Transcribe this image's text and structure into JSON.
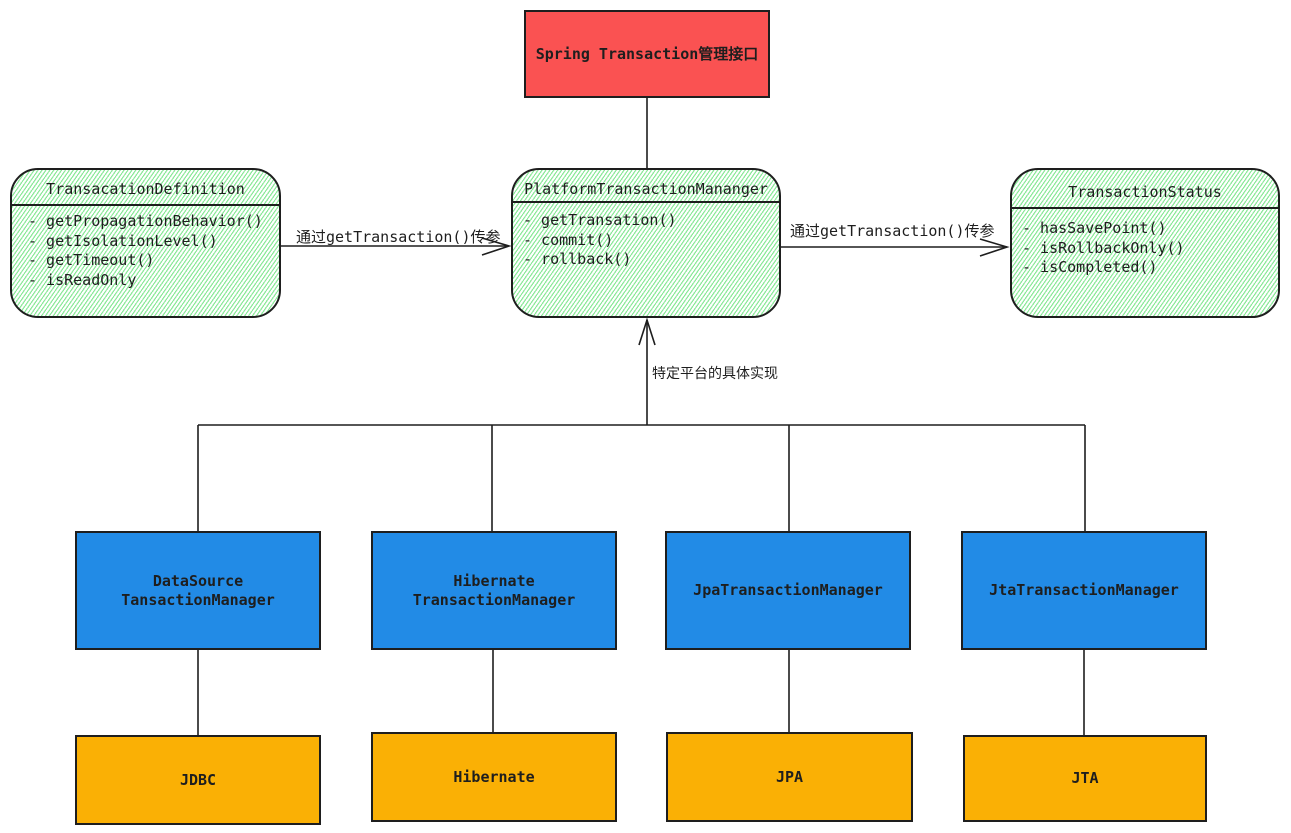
{
  "top": {
    "label": "Spring Transaction管理接口",
    "color": "#fa5252"
  },
  "definition": {
    "title": "TransacationDefinition",
    "methods": [
      "- getPropagationBehavior()",
      "- getIsolationLevel()",
      "- getTimeout()",
      "- isReadOnly"
    ]
  },
  "manager": {
    "title": "PlatformTransactionMananger",
    "methods": [
      "- getTransation()",
      "- commit()",
      "- rollback()"
    ]
  },
  "status": {
    "title": "TransactionStatus",
    "methods": [
      "- hasSavePoint()",
      "- isRollbackOnly()",
      "- isCompleted()"
    ]
  },
  "edges": {
    "left_label": "通过getTransaction()传参",
    "right_label": "通过getTransaction()传参",
    "impl_label": "特定平台的具体实现"
  },
  "implementations": [
    {
      "line1": "DataSource",
      "line2": "TansactionManager",
      "tech": "JDBC"
    },
    {
      "line1": "Hibernate",
      "line2": "TransactionManager",
      "tech": "Hibernate"
    },
    {
      "line1": "JpaTransactionManager",
      "line2": "",
      "tech": "JPA"
    },
    {
      "line1": "JtaTransactionManager",
      "line2": "",
      "tech": "JTA"
    }
  ],
  "colors": {
    "interface_fill": "#8ce99a",
    "impl_fill": "#228be6",
    "tech_fill": "#fab005"
  }
}
